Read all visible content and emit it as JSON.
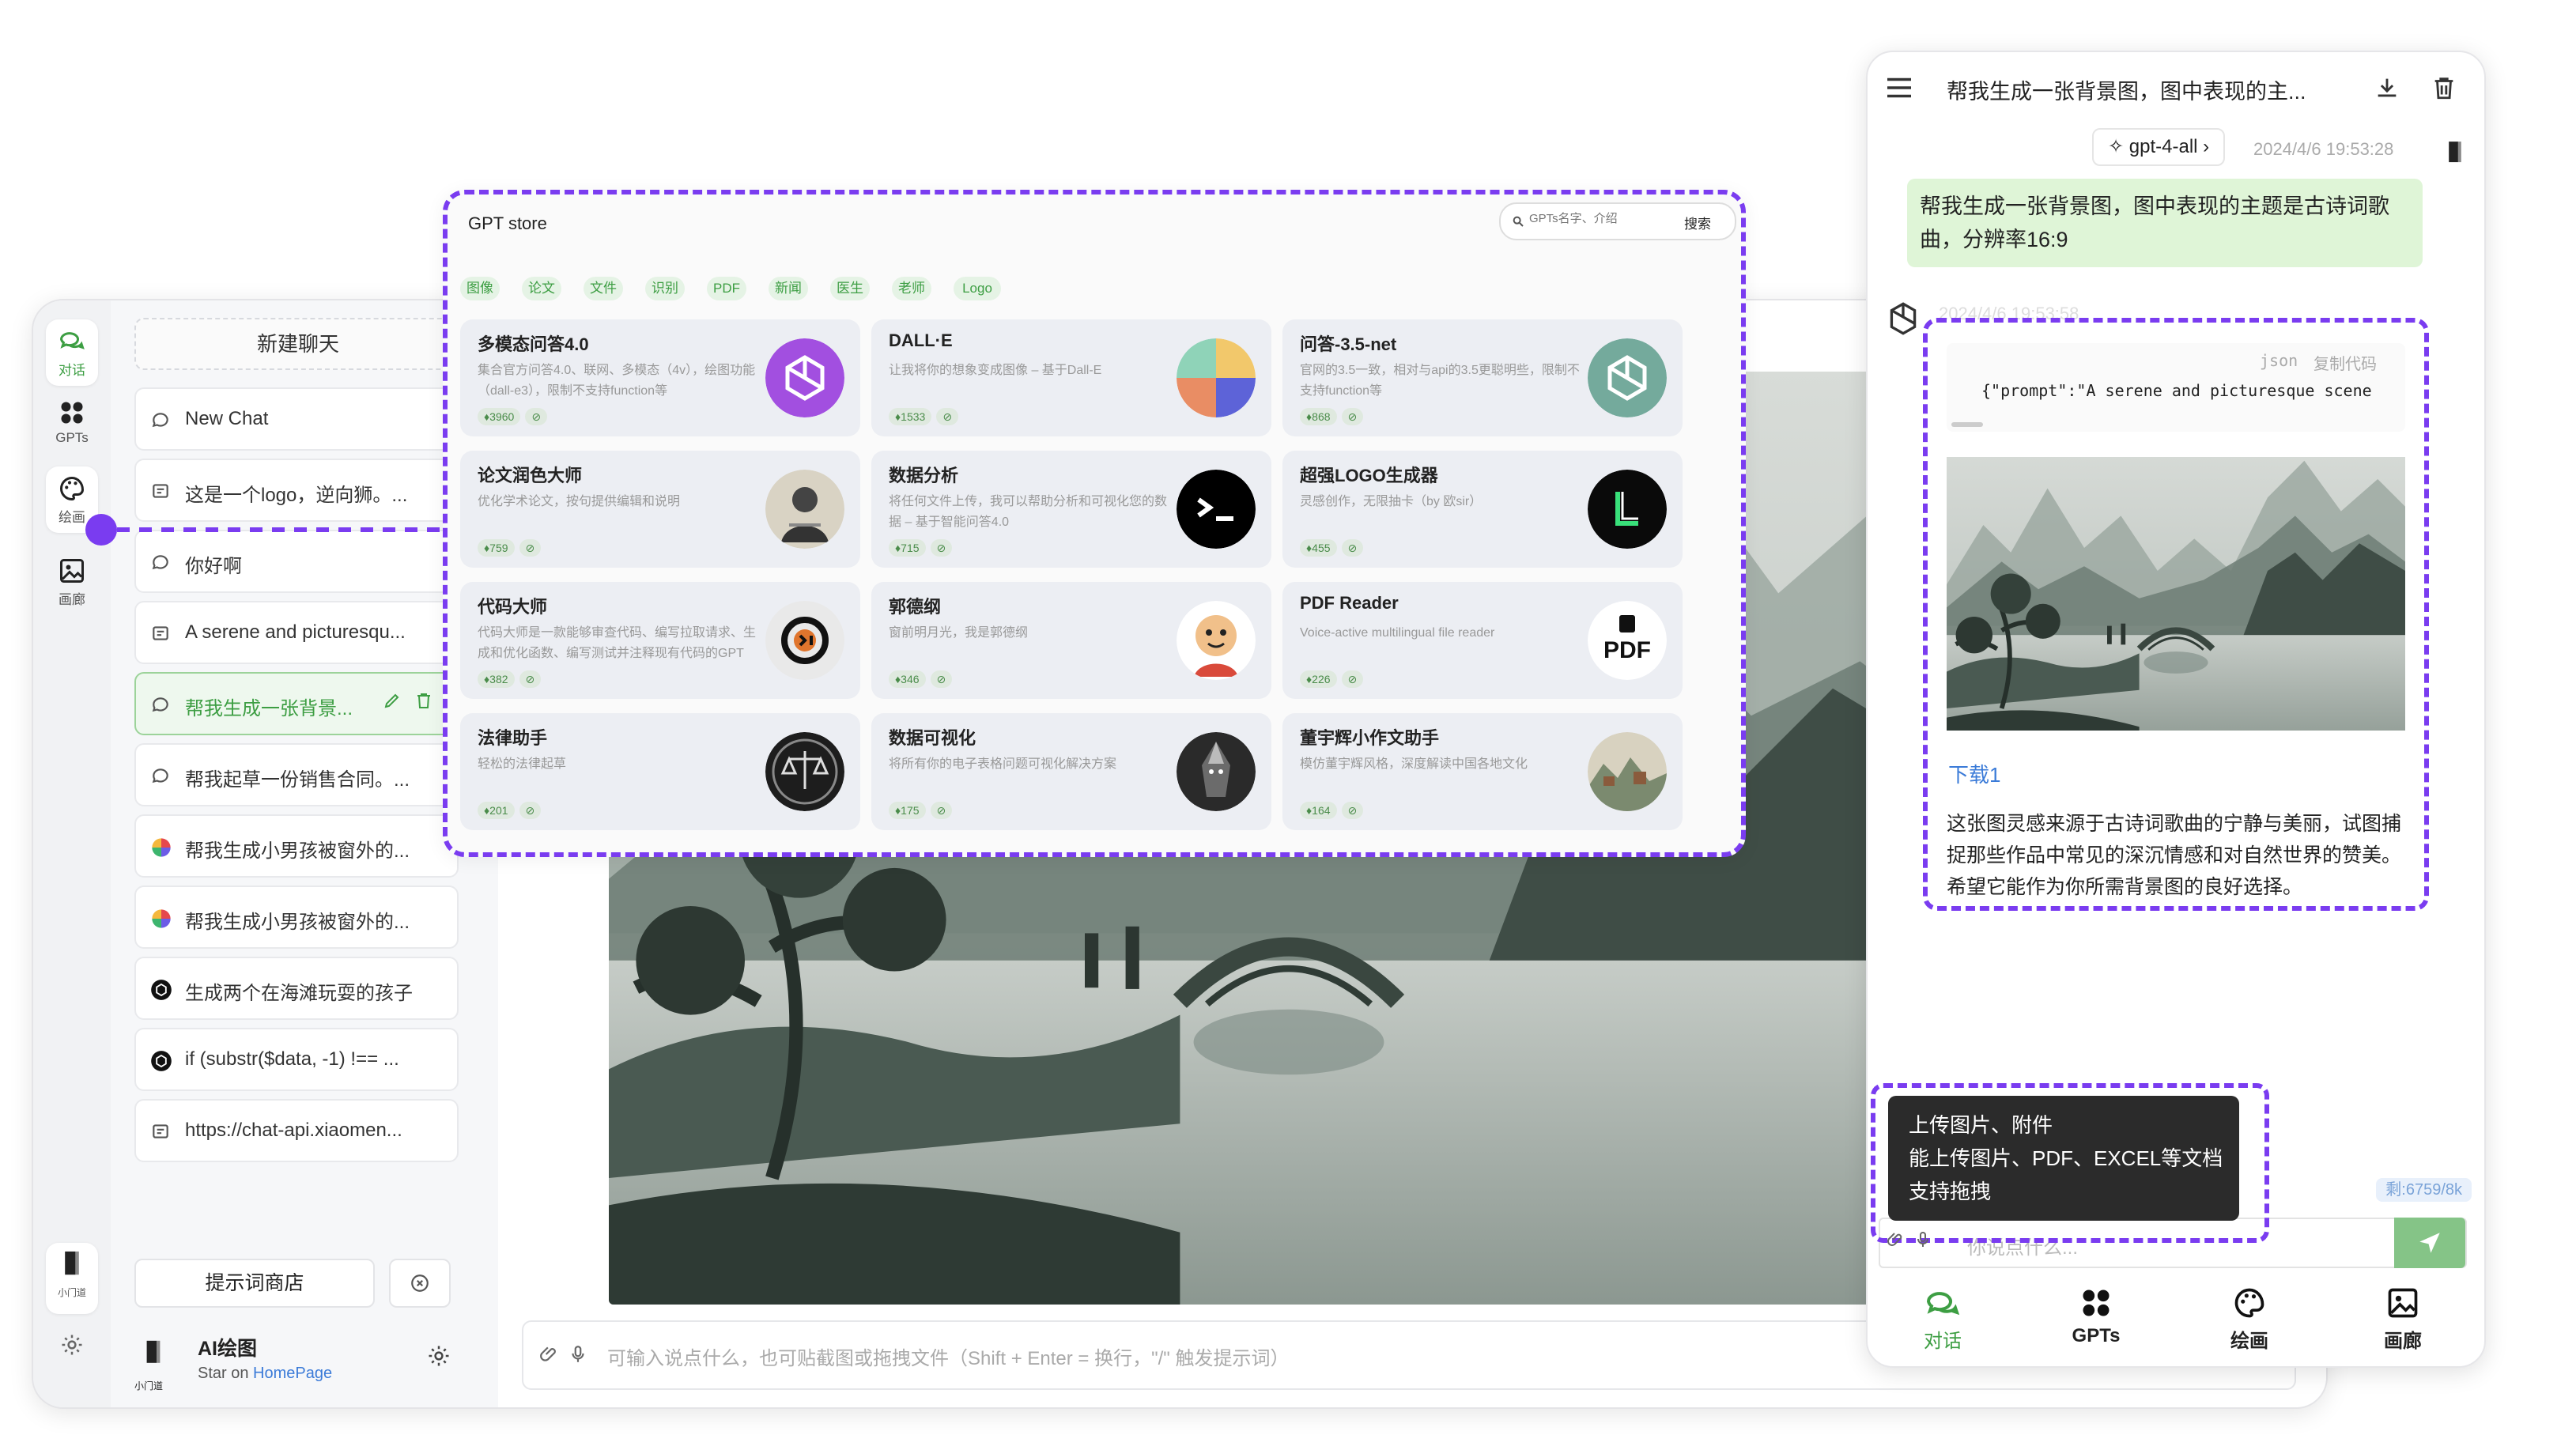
{
  "desktop": {
    "nav": [
      {
        "label": "对话",
        "icon": "chat-bubbles-icon"
      },
      {
        "label": "GPTs",
        "icon": "four-dots-icon"
      },
      {
        "label": "绘画",
        "icon": "palette-icon"
      },
      {
        "label": "画廊",
        "icon": "image-icon"
      }
    ],
    "nav_footer_label": "小门道",
    "new_chat_label": "新建聊天",
    "chats": [
      {
        "title": "New Chat",
        "icon": "message-icon"
      },
      {
        "title": "这是一个logo，逆向狮。...",
        "icon": "image-message-icon"
      },
      {
        "title": "你好啊",
        "icon": "message-icon"
      },
      {
        "title": "A serene and picturesqu...",
        "icon": "image-message-icon"
      },
      {
        "title": "帮我生成一张背景...",
        "icon": "message-icon",
        "active": true
      },
      {
        "title": "帮我起草一份销售合同。...",
        "icon": "message-icon"
      },
      {
        "title": "帮我生成小男孩被窗外的...",
        "icon": "colorwheel-icon"
      },
      {
        "title": "帮我生成小男孩被窗外的...",
        "icon": "colorwheel-icon"
      },
      {
        "title": "生成两个在海滩玩耍的孩子",
        "icon": "openai-icon"
      },
      {
        "title": "if (substr($data, -1) !== ...",
        "icon": "openai-icon"
      },
      {
        "title": "https://chat-api.xiaomen...",
        "icon": "image-message-icon"
      }
    ],
    "prompt_store_label": "提示词商店",
    "brand": {
      "name": "AI绘图",
      "sub_prefix": "Star on",
      "sub_link": "HomePage",
      "logo_label": "小门道"
    },
    "input_placeholder": "可输入说点什么，也可贴截图或拖拽文件（Shift + Enter = 换行，\"/\" 触发提示词）"
  },
  "store": {
    "title": "GPT store",
    "search_placeholder": "GPTs名字、介绍",
    "search_button": "搜索",
    "tags": [
      "图像",
      "论文",
      "文件",
      "识别",
      "PDF",
      "新闻",
      "医生",
      "老师",
      "Logo"
    ],
    "cards": [
      {
        "title": "多模态问答4.0",
        "desc": "集合官方问答4.0、联网、多模态（4v），绘图功能（dall-e3），限制不支持function等",
        "count": "3960",
        "icon": "openai-purple-icon"
      },
      {
        "title": "DALL·E",
        "desc": "让我将你的想象变成图像 – 基于Dall-E",
        "count": "1533",
        "icon": "dalle-wheel-icon"
      },
      {
        "title": "问答-3.5-net",
        "desc": "官网的3.5一致，相对与api的3.5更聪明些，限制不支持function等",
        "count": "868",
        "icon": "openai-green-icon"
      },
      {
        "title": "论文润色大师",
        "desc": "优化学术论文，按句提供编辑和说明",
        "count": "759",
        "icon": "scholar-portrait-icon"
      },
      {
        "title": "数据分析",
        "desc": "将任何文件上传，我可以帮助分析和可视化您的数据 – 基于智能问答4.0",
        "count": "715",
        "icon": "terminal-icon"
      },
      {
        "title": "超强LOGO生成器",
        "desc": "灵感创作，无限抽卡（by 欧sir）",
        "count": "455",
        "icon": "logo-l-icon"
      },
      {
        "title": "代码大师",
        "desc": "代码大师是一款能够审查代码、编写拉取请求、生成和优化函数、编写测试并注释现有代码的GPT",
        "count": "382",
        "icon": "code-master-icon"
      },
      {
        "title": "郭德纲",
        "desc": "窗前明月光，我是郭德纲",
        "count": "346",
        "icon": "cartoon-face-icon"
      },
      {
        "title": "PDF Reader",
        "desc": "Voice-active multilingual file reader",
        "count": "226",
        "icon": "pdf-icon"
      },
      {
        "title": "法律助手",
        "desc": "轻松的法律起草",
        "count": "201",
        "icon": "scales-icon"
      },
      {
        "title": "数据可视化",
        "desc": "将所有你的电子表格问题可视化解决方案",
        "count": "175",
        "icon": "warrior-icon"
      },
      {
        "title": "董宇辉小作文助手",
        "desc": "模仿董宇辉风格，深度解读中国各地文化",
        "count": "164",
        "icon": "landscape-icon"
      }
    ]
  },
  "mobile": {
    "header_title": "帮我生成一张背景图，图中表现的主...",
    "model_label": "gpt-4-all",
    "timestamp_user": "2024/4/6 19:53:28",
    "user_message": "帮我生成一张背景图，图中表现的主题是古诗词歌曲，分辨率16:9",
    "timestamp_bot": "2024/4/6 19:53:58",
    "code_lang": "json",
    "code_copy": "复制代码",
    "code_text": "{\"prompt\":\"A serene and picturesque scene",
    "download_link": "下载1",
    "bot_message": "这张图灵感来源于古诗词歌曲的宁静与美丽，试图捕捉那些作品中常见的深沉情感和对自然世界的赞美。希望它能作为你所需背景图的良好选择。",
    "tooltip_lines": [
      "上传图片、附件",
      "能上传图片、PDF、EXCEL等文档",
      "支持拖拽"
    ],
    "remaining_label": "剩:6759/8k",
    "input_placeholder": "你说点什么...",
    "tabs": [
      {
        "label": "对话",
        "icon": "chat-bubbles-icon",
        "active": true
      },
      {
        "label": "GPTs",
        "icon": "four-dots-icon"
      },
      {
        "label": "绘画",
        "icon": "palette-icon"
      },
      {
        "label": "画廊",
        "icon": "image-icon"
      }
    ],
    "logo_label": "小门道"
  },
  "colors": {
    "accent_purple": "#7a3cf0",
    "accent_green": "#3d9e43",
    "user_bubble": "#dff5d7"
  }
}
